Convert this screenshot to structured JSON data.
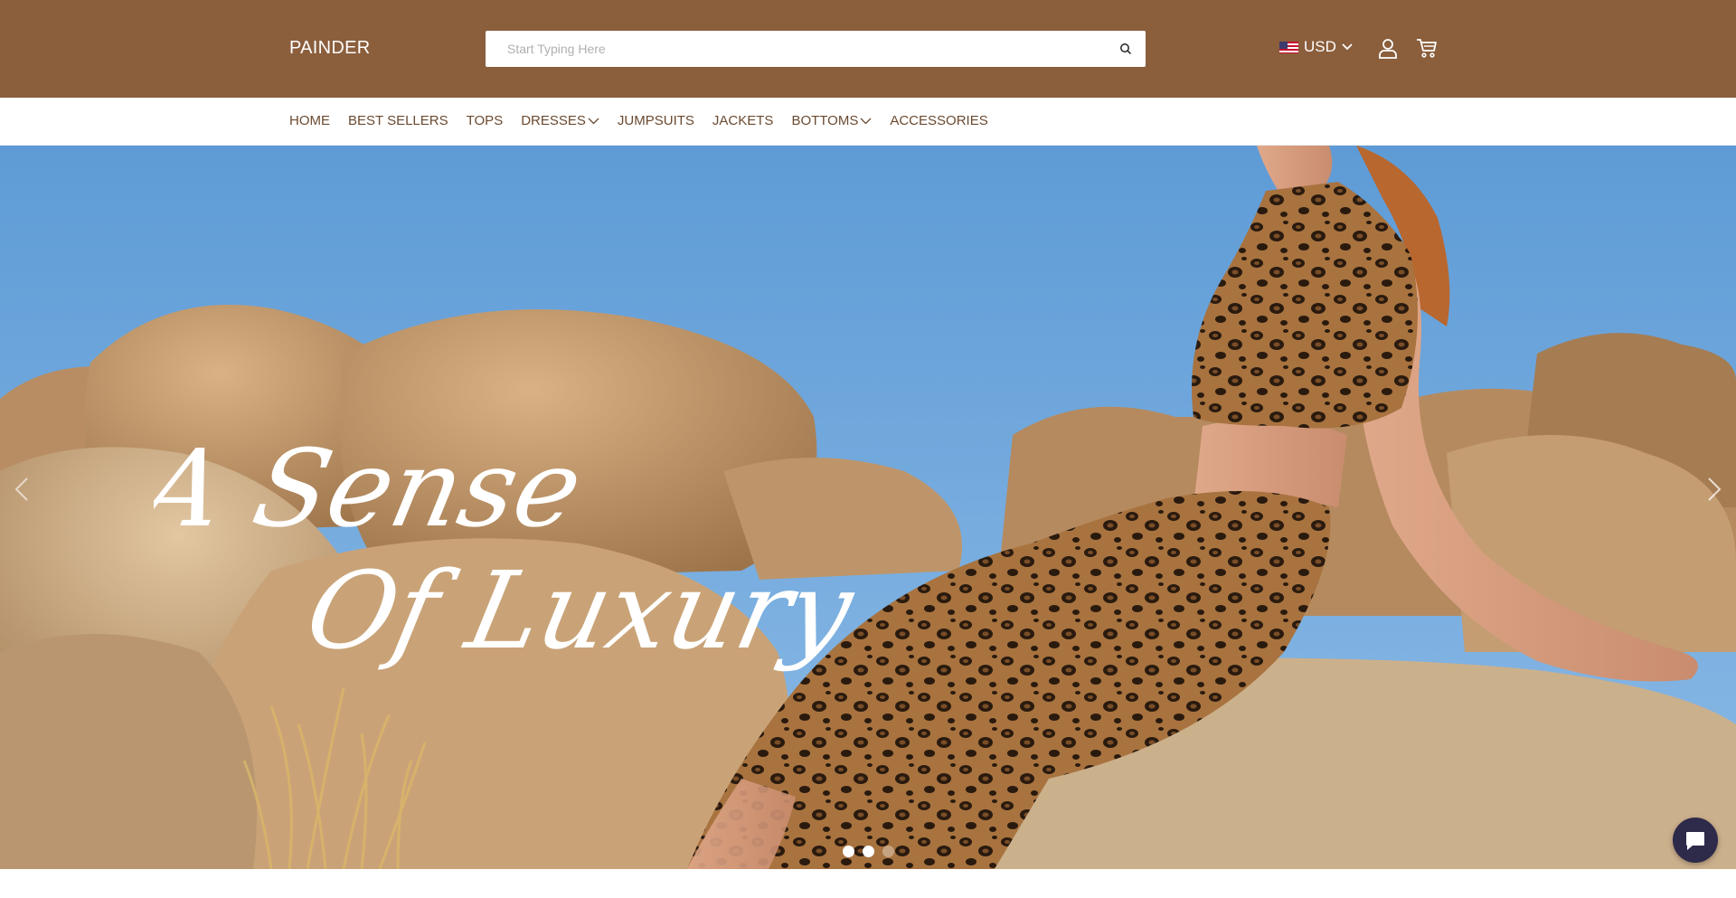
{
  "header": {
    "logo": "PAINDER",
    "search": {
      "placeholder": "Start Typing Here"
    },
    "currency": {
      "code": "USD",
      "flag": "us-flag-icon"
    },
    "icons": [
      "search-icon",
      "user-icon",
      "cart-icon",
      "chevron-down-icon"
    ]
  },
  "nav": {
    "items": [
      {
        "label": "HOME",
        "has_dropdown": false
      },
      {
        "label": "BEST SELLERS",
        "has_dropdown": false
      },
      {
        "label": "TOPS",
        "has_dropdown": false
      },
      {
        "label": "DRESSES",
        "has_dropdown": true
      },
      {
        "label": "JUMPSUITS",
        "has_dropdown": false
      },
      {
        "label": "JACKETS",
        "has_dropdown": false
      },
      {
        "label": "BOTTOMS",
        "has_dropdown": true
      },
      {
        "label": "ACCESSORIES",
        "has_dropdown": false
      }
    ]
  },
  "hero": {
    "headline_line1": "A Sense",
    "headline_line2": "Of Luxury",
    "slide_count": 3,
    "active_slide": 1
  },
  "chat": {
    "icon": "chat-bubble-icon"
  },
  "colors": {
    "header_bg": "#8b5e3c",
    "nav_text": "#6b4a30",
    "sky": "#6fa6d8",
    "rock": "#c49a6c",
    "chat_bg": "#2e2a4a"
  }
}
